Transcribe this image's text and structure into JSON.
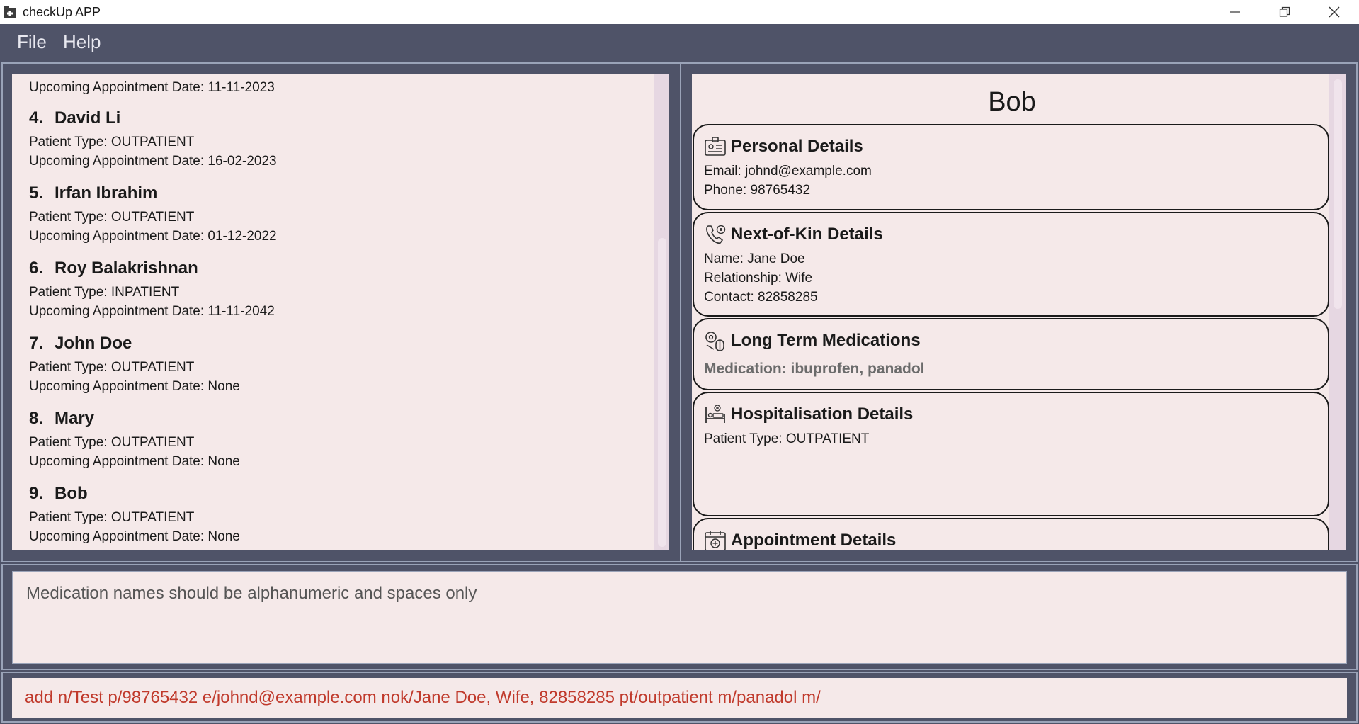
{
  "window": {
    "title": "checkUp APP"
  },
  "menu": {
    "file_label": "File",
    "help_label": "Help"
  },
  "patient_list": {
    "partial_top_line": "Upcoming Appointment Date: 11-11-2023",
    "patients": [
      {
        "index": "4.",
        "name": "David Li",
        "type_line": "Patient Type: OUTPATIENT",
        "appt_line": "Upcoming Appointment Date: 16-02-2023"
      },
      {
        "index": "5.",
        "name": "Irfan Ibrahim",
        "type_line": "Patient Type: OUTPATIENT",
        "appt_line": "Upcoming Appointment Date: 01-12-2022"
      },
      {
        "index": "6.",
        "name": "Roy Balakrishnan",
        "type_line": "Patient Type: INPATIENT",
        "appt_line": "Upcoming Appointment Date: 11-11-2042"
      },
      {
        "index": "7.",
        "name": "John Doe",
        "type_line": "Patient Type: OUTPATIENT",
        "appt_line": "Upcoming Appointment Date: None"
      },
      {
        "index": "8.",
        "name": "Mary",
        "type_line": "Patient Type: OUTPATIENT",
        "appt_line": "Upcoming Appointment Date: None"
      },
      {
        "index": "9.",
        "name": "Bob",
        "type_line": "Patient Type: OUTPATIENT",
        "appt_line": "Upcoming Appointment Date: None"
      }
    ]
  },
  "detail": {
    "patient_name": "Bob",
    "personal": {
      "title": "Personal Details",
      "email": "Email: johnd@example.com",
      "phone": "Phone: 98765432",
      "icon": "id-card-icon"
    },
    "next_of_kin": {
      "title": "Next-of-Kin Details",
      "name": "Name: Jane Doe",
      "relationship": "Relationship: Wife",
      "contact": "Contact: 82858285",
      "icon": "phone-contact-icon"
    },
    "medications": {
      "title": "Long Term Medications",
      "medication": "Medication: ibuprofen, panadol",
      "icon": "pills-icon"
    },
    "hospitalisation": {
      "title": "Hospitalisation Details",
      "patient_type": "Patient Type: OUTPATIENT",
      "icon": "hospital-bed-icon"
    },
    "appointment": {
      "title": "Appointment Details",
      "icon": "calendar-icon"
    }
  },
  "result": {
    "message": "Medication names should be alphanumeric and spaces only"
  },
  "command": {
    "text": "add n/Test p/98765432 e/johnd@example.com nok/Jane Doe, Wife, 82858285 pt/outpatient m/panadol m/"
  },
  "colors": {
    "background": "#4f5368",
    "panel": "#f5e9e9",
    "command_text": "#c0392b"
  }
}
